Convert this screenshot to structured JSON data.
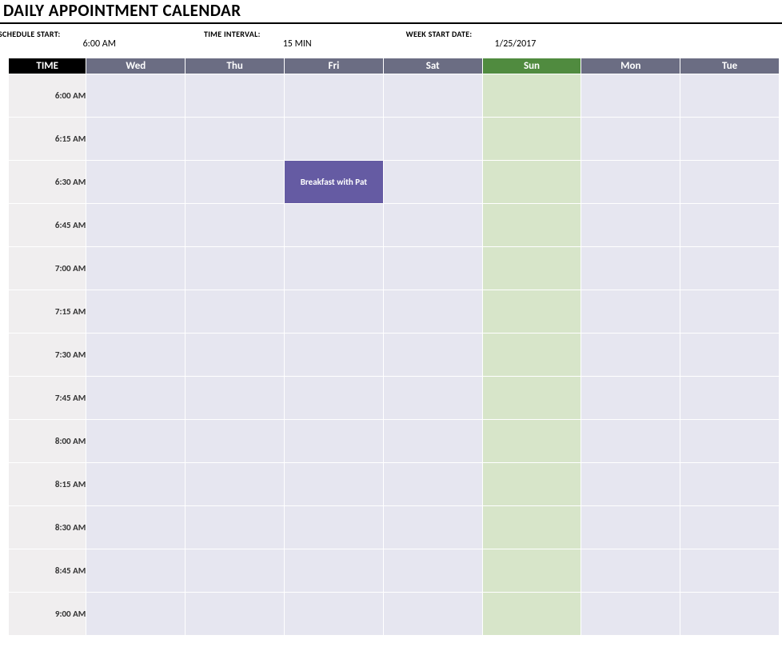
{
  "title": "DAILY APPOINTMENT CALENDAR",
  "controls": {
    "schedule_start_label": "SCHEDULE START:",
    "schedule_start_value": "6:00 AM",
    "interval_label": "TIME INTERVAL:",
    "interval_value": "15 MIN",
    "week_start_label": "WEEK START DATE:",
    "week_start_value": "1/25/2017"
  },
  "headers": {
    "time": "TIME",
    "days": [
      "Wed",
      "Thu",
      "Fri",
      "Sat",
      "Sun",
      "Mon",
      "Tue"
    ]
  },
  "highlight_day_index": 4,
  "rows": [
    {
      "time": "6:00 AM",
      "cells": [
        null,
        null,
        null,
        null,
        null,
        null,
        null
      ]
    },
    {
      "time": "6:15 AM",
      "cells": [
        null,
        null,
        null,
        null,
        null,
        null,
        null
      ]
    },
    {
      "time": "6:30 AM",
      "cells": [
        null,
        null,
        "Breakfast with Pat",
        null,
        null,
        null,
        null
      ]
    },
    {
      "time": "6:45 AM",
      "cells": [
        null,
        null,
        null,
        null,
        null,
        null,
        null
      ]
    },
    {
      "time": "7:00 AM",
      "cells": [
        null,
        null,
        null,
        null,
        null,
        null,
        null
      ]
    },
    {
      "time": "7:15 AM",
      "cells": [
        null,
        null,
        null,
        null,
        null,
        null,
        null
      ]
    },
    {
      "time": "7:30 AM",
      "cells": [
        null,
        null,
        null,
        null,
        null,
        null,
        null
      ]
    },
    {
      "time": "7:45 AM",
      "cells": [
        null,
        null,
        null,
        null,
        null,
        null,
        null
      ]
    },
    {
      "time": "8:00 AM",
      "cells": [
        null,
        null,
        null,
        null,
        null,
        null,
        null
      ]
    },
    {
      "time": "8:15 AM",
      "cells": [
        null,
        null,
        null,
        null,
        null,
        null,
        null
      ]
    },
    {
      "time": "8:30 AM",
      "cells": [
        null,
        null,
        null,
        null,
        null,
        null,
        null
      ]
    },
    {
      "time": "8:45 AM",
      "cells": [
        null,
        null,
        null,
        null,
        null,
        null,
        null
      ]
    },
    {
      "time": "9:00 AM",
      "cells": [
        null,
        null,
        null,
        null,
        null,
        null,
        null
      ]
    }
  ],
  "appointment_color": "#655ba3"
}
